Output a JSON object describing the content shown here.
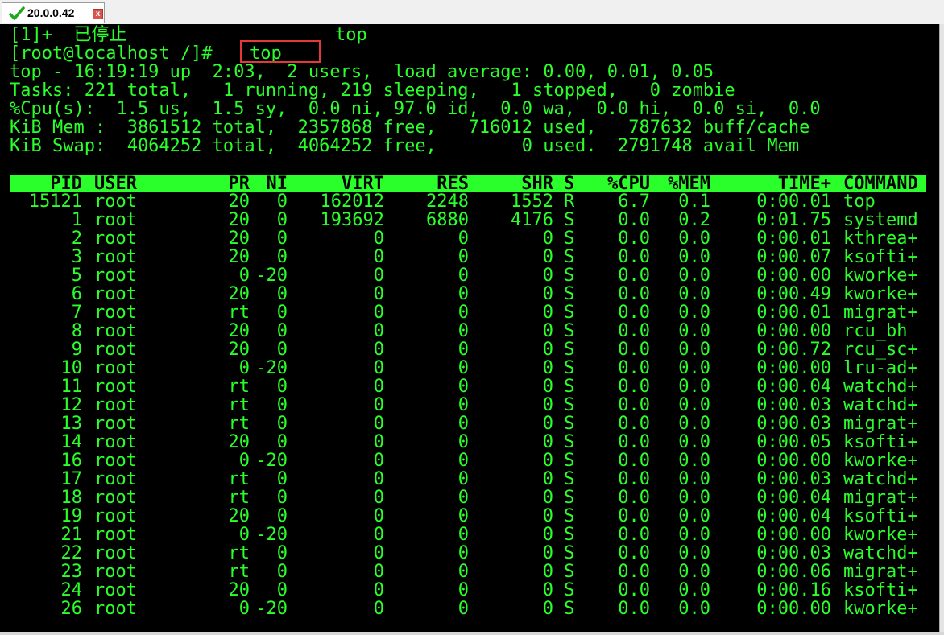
{
  "tab": {
    "title": "20.0.0.42",
    "close": "x"
  },
  "term": {
    "job_line": {
      "prefix": "[1]+  ",
      "status": "已停止",
      "job": "top"
    },
    "prompt": "[root@localhost /]#",
    "command": "top",
    "summary": [
      "top - 16:19:19 up  2:03,  2 users,  load average: 0.00, 0.01, 0.05",
      "Tasks: 221 total,   1 running, 219 sleeping,   1 stopped,   0 zombie",
      "%Cpu(s):  1.5 us,  1.5 sy,  0.0 ni, 97.0 id,  0.0 wa,  0.0 hi,  0.0 si,  0.0",
      "KiB Mem :  3861512 total,  2357868 free,   716012 used,   787632 buff/cache",
      "KiB Swap:  4064252 total,  4064252 free,        0 used.  2791748 avail Mem"
    ]
  },
  "table": {
    "headers": [
      "PID",
      "USER",
      "PR",
      "NI",
      "VIRT",
      "RES",
      "SHR",
      "S",
      "%CPU",
      "%MEM",
      "TIME+",
      "COMMAND"
    ],
    "rows": [
      [
        "15121",
        "root",
        "20",
        "0",
        "162012",
        "2248",
        "1552",
        "R",
        "6.7",
        "0.1",
        "0:00.01",
        "top"
      ],
      [
        "1",
        "root",
        "20",
        "0",
        "193692",
        "6880",
        "4176",
        "S",
        "0.0",
        "0.2",
        "0:01.75",
        "systemd"
      ],
      [
        "2",
        "root",
        "20",
        "0",
        "0",
        "0",
        "0",
        "S",
        "0.0",
        "0.0",
        "0:00.01",
        "kthrea+"
      ],
      [
        "3",
        "root",
        "20",
        "0",
        "0",
        "0",
        "0",
        "S",
        "0.0",
        "0.0",
        "0:00.07",
        "ksofti+"
      ],
      [
        "5",
        "root",
        "0",
        "-20",
        "0",
        "0",
        "0",
        "S",
        "0.0",
        "0.0",
        "0:00.00",
        "kworke+"
      ],
      [
        "6",
        "root",
        "20",
        "0",
        "0",
        "0",
        "0",
        "S",
        "0.0",
        "0.0",
        "0:00.49",
        "kworke+"
      ],
      [
        "7",
        "root",
        "rt",
        "0",
        "0",
        "0",
        "0",
        "S",
        "0.0",
        "0.0",
        "0:00.01",
        "migrat+"
      ],
      [
        "8",
        "root",
        "20",
        "0",
        "0",
        "0",
        "0",
        "S",
        "0.0",
        "0.0",
        "0:00.00",
        "rcu_bh"
      ],
      [
        "9",
        "root",
        "20",
        "0",
        "0",
        "0",
        "0",
        "S",
        "0.0",
        "0.0",
        "0:00.72",
        "rcu_sc+"
      ],
      [
        "10",
        "root",
        "0",
        "-20",
        "0",
        "0",
        "0",
        "S",
        "0.0",
        "0.0",
        "0:00.00",
        "lru-ad+"
      ],
      [
        "11",
        "root",
        "rt",
        "0",
        "0",
        "0",
        "0",
        "S",
        "0.0",
        "0.0",
        "0:00.04",
        "watchd+"
      ],
      [
        "12",
        "root",
        "rt",
        "0",
        "0",
        "0",
        "0",
        "S",
        "0.0",
        "0.0",
        "0:00.03",
        "watchd+"
      ],
      [
        "13",
        "root",
        "rt",
        "0",
        "0",
        "0",
        "0",
        "S",
        "0.0",
        "0.0",
        "0:00.03",
        "migrat+"
      ],
      [
        "14",
        "root",
        "20",
        "0",
        "0",
        "0",
        "0",
        "S",
        "0.0",
        "0.0",
        "0:00.05",
        "ksofti+"
      ],
      [
        "16",
        "root",
        "0",
        "-20",
        "0",
        "0",
        "0",
        "S",
        "0.0",
        "0.0",
        "0:00.00",
        "kworke+"
      ],
      [
        "17",
        "root",
        "rt",
        "0",
        "0",
        "0",
        "0",
        "S",
        "0.0",
        "0.0",
        "0:00.03",
        "watchd+"
      ],
      [
        "18",
        "root",
        "rt",
        "0",
        "0",
        "0",
        "0",
        "S",
        "0.0",
        "0.0",
        "0:00.04",
        "migrat+"
      ],
      [
        "19",
        "root",
        "20",
        "0",
        "0",
        "0",
        "0",
        "S",
        "0.0",
        "0.0",
        "0:00.04",
        "ksofti+"
      ],
      [
        "21",
        "root",
        "0",
        "-20",
        "0",
        "0",
        "0",
        "S",
        "0.0",
        "0.0",
        "0:00.00",
        "kworke+"
      ],
      [
        "22",
        "root",
        "rt",
        "0",
        "0",
        "0",
        "0",
        "S",
        "0.0",
        "0.0",
        "0:00.03",
        "watchd+"
      ],
      [
        "23",
        "root",
        "rt",
        "0",
        "0",
        "0",
        "0",
        "S",
        "0.0",
        "0.0",
        "0:00.06",
        "migrat+"
      ],
      [
        "24",
        "root",
        "20",
        "0",
        "0",
        "0",
        "0",
        "S",
        "0.0",
        "0.0",
        "0:00.16",
        "ksofti+"
      ],
      [
        "26",
        "root",
        "0",
        "-20",
        "0",
        "0",
        "0",
        "S",
        "0.0",
        "0.0",
        "0:00.00",
        "kworke+"
      ]
    ]
  },
  "colors": {
    "terminal_bg": "#000000",
    "terminal_fg": "#2bff2b",
    "highlight_box": "#e53935"
  },
  "icons": {
    "tab_status": "check-icon",
    "tab_close": "close-icon"
  }
}
